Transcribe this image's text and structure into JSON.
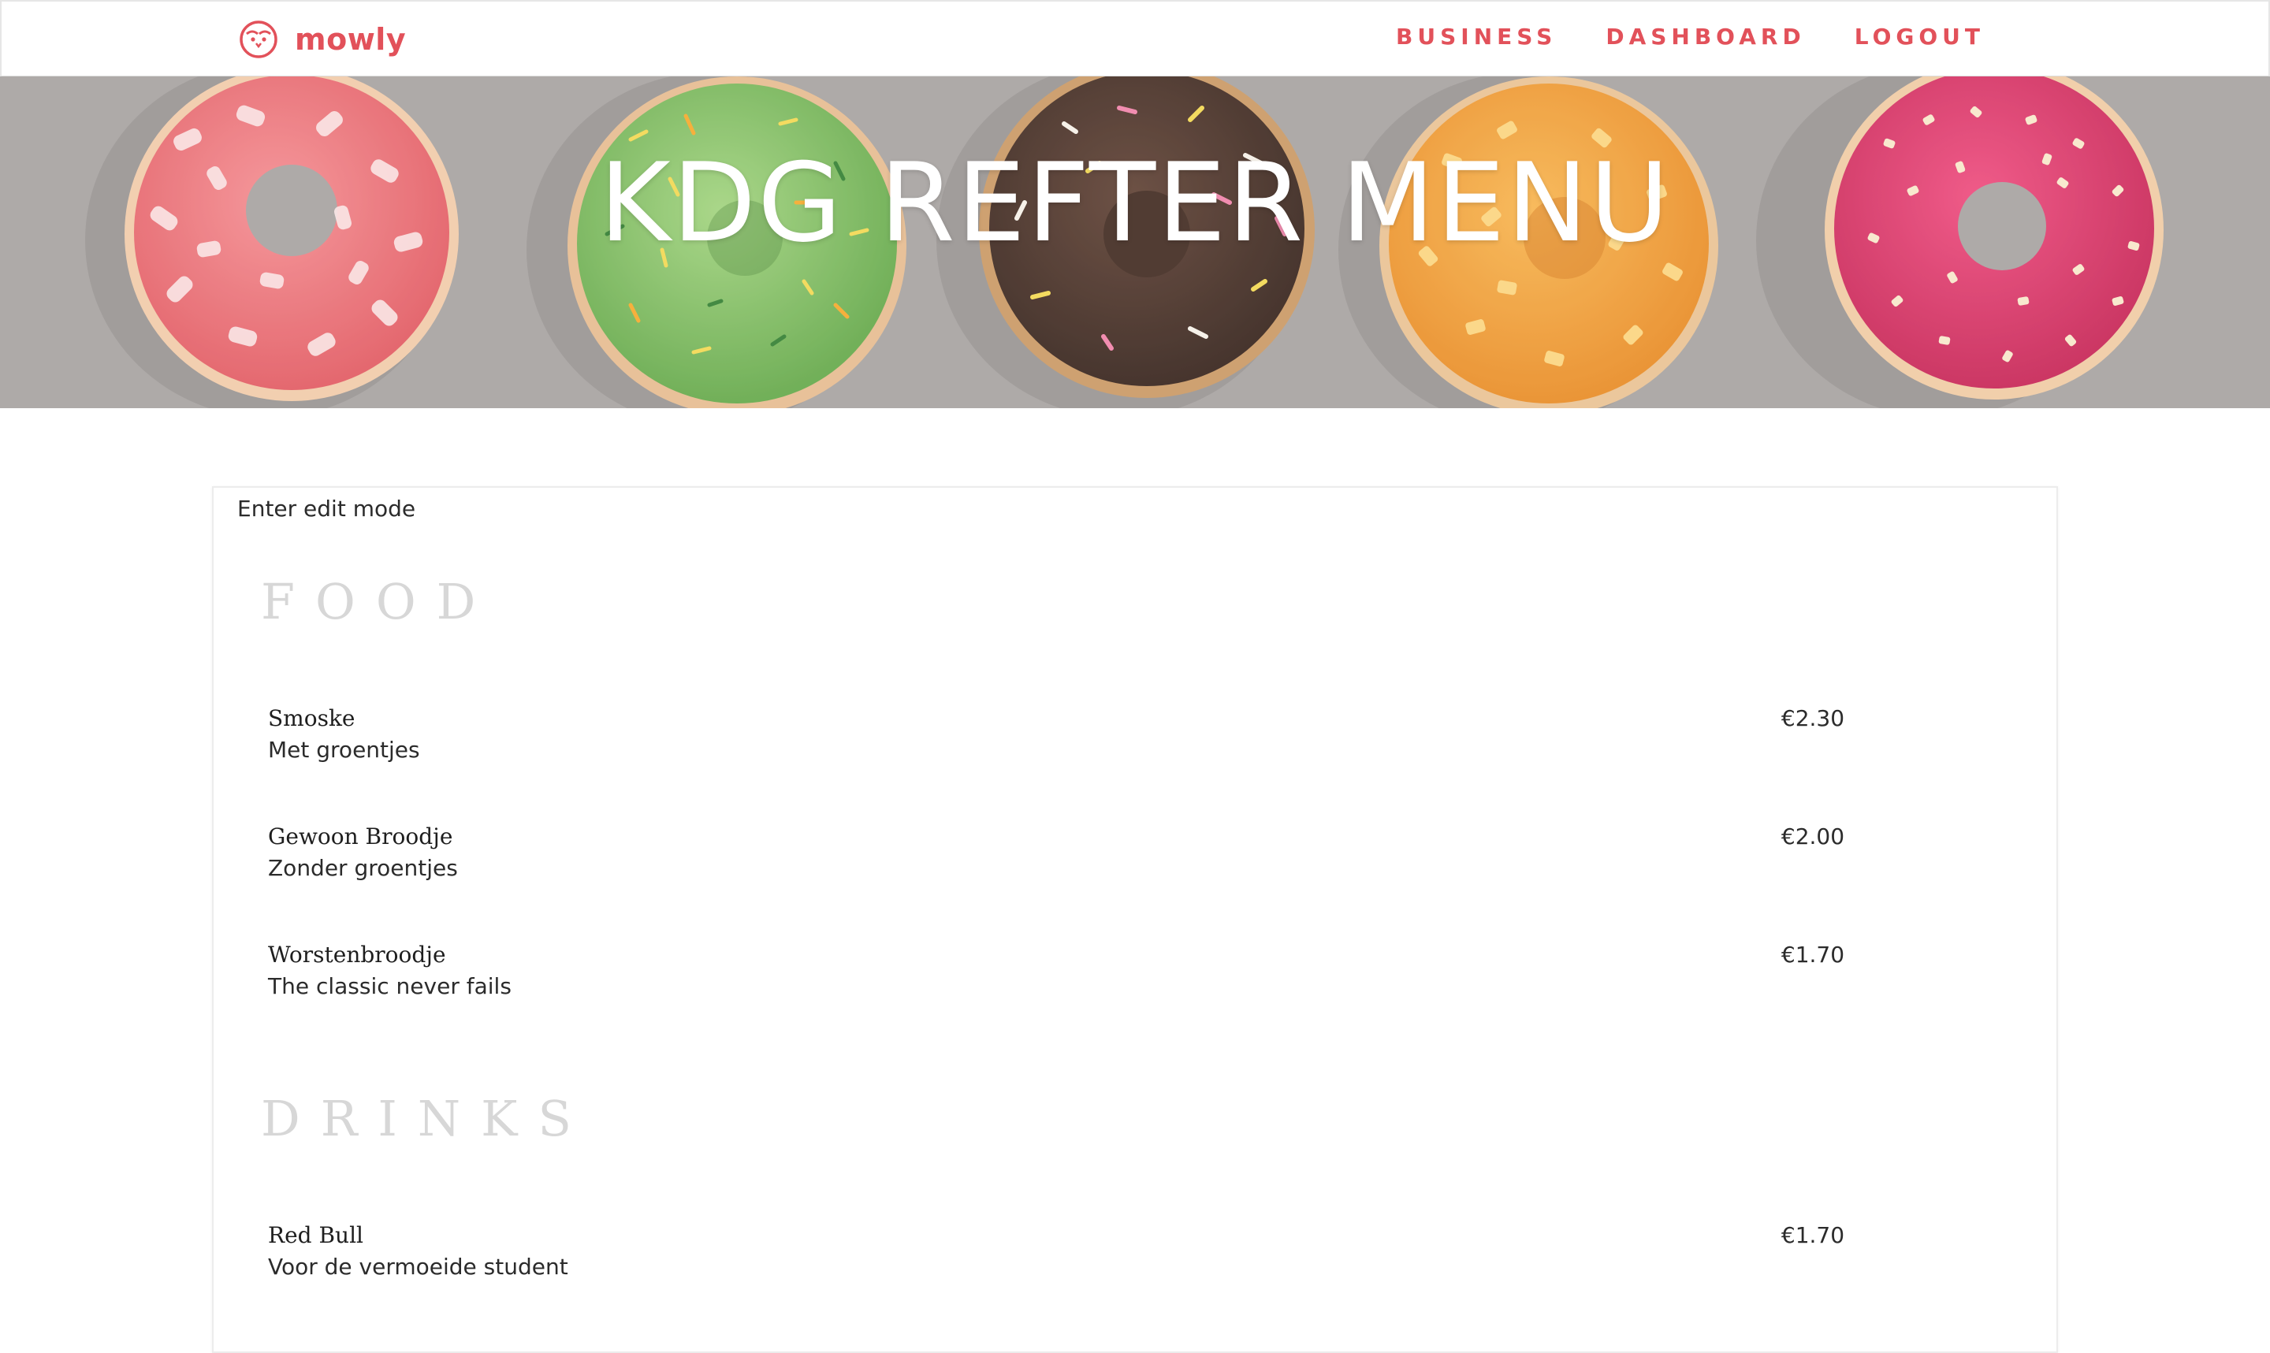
{
  "navbar": {
    "brand": "mowly",
    "links": [
      "BUSINESS",
      "DASHBOARD",
      "LOGOUT"
    ]
  },
  "hero": {
    "title": "KDG REFTER MENU"
  },
  "menu": {
    "edit_label": "Enter edit mode",
    "sections": [
      {
        "title": "FOOD",
        "items": [
          {
            "name": "Smoske",
            "description": "Met groentjes",
            "price": "€2.30"
          },
          {
            "name": "Gewoon Broodje",
            "description": "Zonder groentjes",
            "price": "€2.00"
          },
          {
            "name": "Worstenbroodje",
            "description": "The classic never fails",
            "price": "€1.70"
          }
        ]
      },
      {
        "title": "DRINKS",
        "items": [
          {
            "name": "Red Bull",
            "description": "Voor de vermoeide student",
            "price": "€1.70"
          }
        ]
      }
    ]
  },
  "colors": {
    "accent": "#e2515a",
    "hero_bg": "#a39f9d",
    "section_title": "#d7d7d7"
  },
  "icons": {
    "brand": "owl-face-icon"
  }
}
